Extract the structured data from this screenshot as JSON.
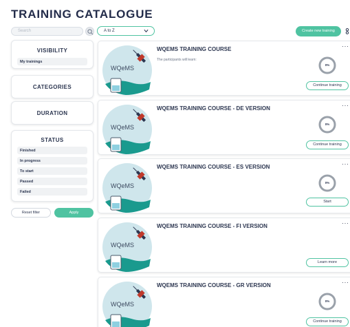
{
  "header": {
    "title": "TRAINING CATALOGUE"
  },
  "toolbar": {
    "search_placeholder": "Search",
    "sort_value": "A to Z",
    "create_label": "Create new training"
  },
  "filters": {
    "visibility": {
      "title": "VISIBILITY",
      "items": [
        "My trainings"
      ]
    },
    "categories": {
      "title": "CATEGORIES"
    },
    "duration": {
      "title": "DURATION"
    },
    "status": {
      "title": "STATUS",
      "items": [
        "Finished",
        "In progress",
        "To start",
        "Passed",
        "Failed"
      ]
    },
    "reset_label": "Reset filter",
    "apply_label": "Apply"
  },
  "courses": [
    {
      "title": "WQEMS TRAINING COURSE",
      "description": "The participants will learn:",
      "progress_label": "0%",
      "action": "Continue training",
      "thumb_text": "WQeMS"
    },
    {
      "title": "WQEMS TRAINING COURSE - DE VERSION",
      "description": "",
      "progress_label": "0%",
      "action": "Continue training",
      "thumb_text": "WQeMS"
    },
    {
      "title": "WQEMS TRAINING COURSE - ES VERSION",
      "description": "",
      "progress_label": "0%",
      "action": "Start",
      "thumb_text": "WQeMS"
    },
    {
      "title": "WQEMS TRAINING COURSE - FI VERSION",
      "description": "",
      "progress_label": "",
      "action": "Learn more",
      "thumb_text": "WQeMS"
    },
    {
      "title": "WQEMS TRAINING COURSE - GR VERSION",
      "description": "",
      "progress_label": "0%",
      "action": "Continue training",
      "thumb_text": "WQeMS"
    }
  ],
  "colors": {
    "accent": "#4fc3a1",
    "title": "#232c4a",
    "thumb_circle": "#cfe6ec",
    "water": "#1a9a8e"
  },
  "icons": {
    "search": "search-icon",
    "sort": "chevron-down-icon",
    "view": "grid-view-icon",
    "more": "more-dots-icon",
    "thumb": "satellite-icon"
  }
}
